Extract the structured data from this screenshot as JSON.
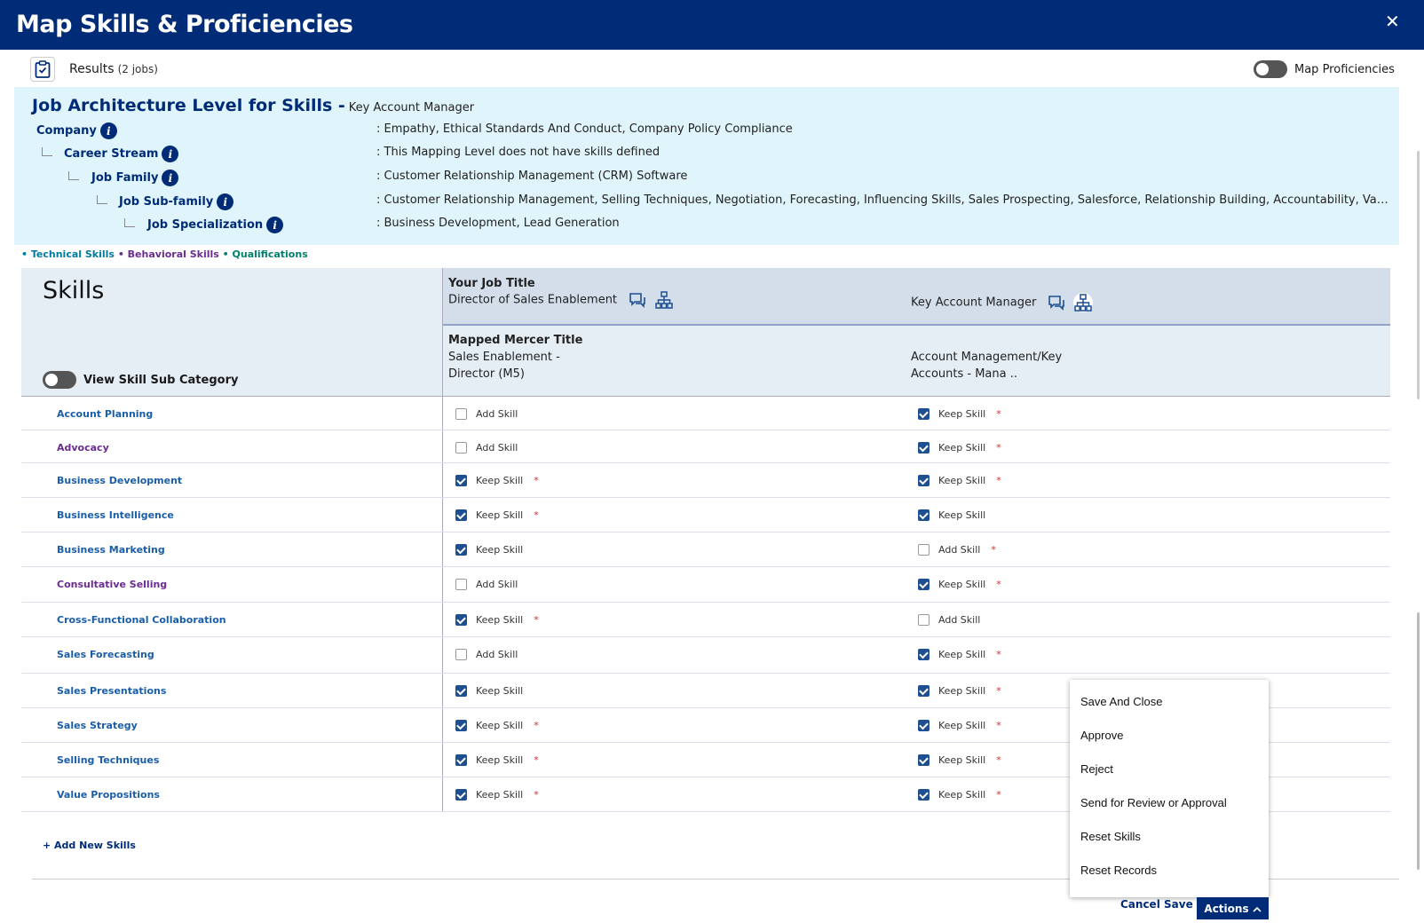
{
  "header": {
    "title": "Map Skills & Proficiencies",
    "close_label": "✕"
  },
  "results": {
    "label": "Results",
    "count": "(2 jobs)",
    "toggle_label": "Map Proficiencies"
  },
  "architecture": {
    "title": "Job Architecture Level for Skills -",
    "job": "Key Account Manager",
    "levels": [
      {
        "label": "Company",
        "value": ": Empathy, Ethical Standards And Conduct, Company Policy Compliance"
      },
      {
        "label": "Career Stream",
        "value": ": This Mapping Level does not have skills defined"
      },
      {
        "label": "Job Family",
        "value": ": Customer Relationship Management (CRM) Software"
      },
      {
        "label": "Job Sub-family",
        "value": ": Customer Relationship Management, Selling Techniques, Negotiation, Forecasting, Influencing Skills, Sales Prospecting, Salesforce, Relationship Building, Accountability, Value Propositi..."
      },
      {
        "label": "Job Specialization",
        "value": ": Business Development, Lead Generation"
      }
    ]
  },
  "legend": {
    "technical": "• Technical Skills",
    "behavioral": "• Behavioral Skills",
    "qualifications": "• Qualifications"
  },
  "table": {
    "title": "Skills",
    "subcat_toggle": "View Skill Sub Category",
    "your_job_label": "Your Job Title",
    "mercer_label": "Mapped Mercer Title",
    "jobs": [
      {
        "title": "Director of Sales Enablement",
        "mercer_line1": "Sales Enablement -",
        "mercer_line2": "Director (M5)"
      },
      {
        "title": "Key Account Manager",
        "mercer_line1": "Account Management/Key",
        "mercer_line2": "Accounts - Mana .."
      }
    ],
    "rows": [
      {
        "name": "Account Planning",
        "type": "technical",
        "c1": {
          "checked": false,
          "label": "Add Skill",
          "req": false
        },
        "c2": {
          "checked": true,
          "label": "Keep Skill",
          "req": true
        }
      },
      {
        "name": "Advocacy",
        "type": "behavioral",
        "c1": {
          "checked": false,
          "label": "Add Skill",
          "req": false
        },
        "c2": {
          "checked": true,
          "label": "Keep Skill",
          "req": true
        }
      },
      {
        "name": "Business Development",
        "type": "technical",
        "c1": {
          "checked": true,
          "label": "Keep Skill",
          "req": true
        },
        "c2": {
          "checked": true,
          "label": "Keep Skill",
          "req": true
        }
      },
      {
        "name": "Business Intelligence",
        "type": "technical",
        "c1": {
          "checked": true,
          "label": "Keep Skill",
          "req": true
        },
        "c2": {
          "checked": true,
          "label": "Keep Skill",
          "req": false
        }
      },
      {
        "name": "Business Marketing",
        "type": "technical",
        "c1": {
          "checked": true,
          "label": "Keep Skill",
          "req": false
        },
        "c2": {
          "checked": false,
          "label": "Add Skill",
          "req": true
        }
      },
      {
        "name": "Consultative Selling",
        "type": "behavioral",
        "c1": {
          "checked": false,
          "label": "Add Skill",
          "req": false
        },
        "c2": {
          "checked": true,
          "label": "Keep Skill",
          "req": true
        }
      },
      {
        "name": "Cross-Functional Collaboration",
        "type": "technical",
        "c1": {
          "checked": true,
          "label": "Keep Skill",
          "req": true
        },
        "c2": {
          "checked": false,
          "label": "Add Skill",
          "req": false
        }
      },
      {
        "name": "Sales Forecasting",
        "type": "technical",
        "c1": {
          "checked": false,
          "label": "Add Skill",
          "req": false
        },
        "c2": {
          "checked": true,
          "label": "Keep Skill",
          "req": true
        }
      },
      {
        "name": "Sales Presentations",
        "type": "technical",
        "c1": {
          "checked": true,
          "label": "Keep Skill",
          "req": false
        },
        "c2": {
          "checked": true,
          "label": "Keep Skill",
          "req": true
        }
      },
      {
        "name": "Sales Strategy",
        "type": "technical",
        "c1": {
          "checked": true,
          "label": "Keep Skill",
          "req": true
        },
        "c2": {
          "checked": true,
          "label": "Keep Skill",
          "req": true
        }
      },
      {
        "name": "Selling Techniques",
        "type": "technical",
        "c1": {
          "checked": true,
          "label": "Keep Skill",
          "req": true
        },
        "c2": {
          "checked": true,
          "label": "Keep Skill",
          "req": true
        }
      },
      {
        "name": "Value Propositions",
        "type": "technical",
        "c1": {
          "checked": true,
          "label": "Keep Skill",
          "req": true
        },
        "c2": {
          "checked": true,
          "label": "Keep Skill",
          "req": true
        }
      }
    ],
    "add_new": "+ Add New Skills"
  },
  "actions_menu": {
    "items": [
      "Save And Close",
      "Approve",
      "Reject",
      "Send for Review or Approval",
      "Reset Skills",
      "Reset Records"
    ]
  },
  "footer": {
    "cancel": "Cancel",
    "save": "Save",
    "actions": "Actions"
  },
  "colors": {
    "brand": "#002c77",
    "header_bg": "#002c77",
    "arch_bg": "#e0f4fb",
    "checkbox": "#1d4f91",
    "required": "#d32f2f",
    "technical": "#1a5ea8",
    "behavioral": "#6b2c91",
    "qualification": "#00806b"
  }
}
